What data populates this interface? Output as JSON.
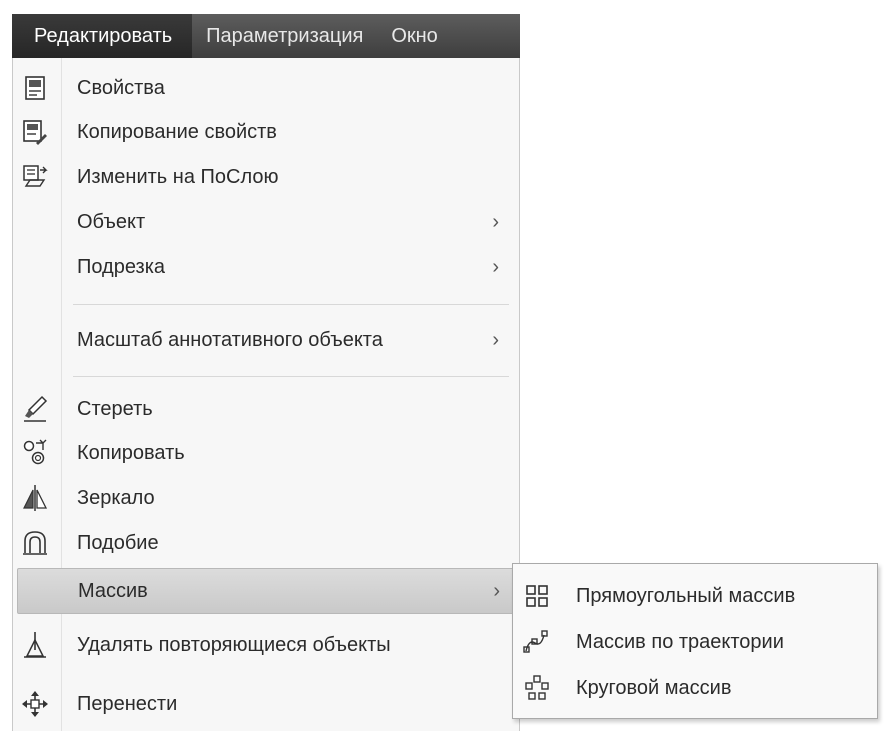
{
  "menubar": {
    "items": [
      {
        "label": "Редактировать"
      },
      {
        "label": "Параметризация"
      },
      {
        "label": "Окно"
      }
    ]
  },
  "edit_menu": {
    "items": [
      {
        "label": "Свойства",
        "icon": "properties-icon"
      },
      {
        "label": "Копирование свойств",
        "icon": "match-properties-icon"
      },
      {
        "label": "Изменить на ПоСлою",
        "icon": "change-to-bylayer-icon"
      },
      {
        "label": "Объект",
        "submenu_arrow": "›"
      },
      {
        "label": "Подрезка",
        "submenu_arrow": "›"
      },
      {
        "label": "Масштаб аннотативного объекта",
        "submenu_arrow": "›"
      },
      {
        "label": "Стереть",
        "icon": "erase-icon"
      },
      {
        "label": "Копировать",
        "icon": "copy-icon"
      },
      {
        "label": "Зеркало",
        "icon": "mirror-icon"
      },
      {
        "label": "Подобие",
        "icon": "offset-icon"
      },
      {
        "label": "Массив",
        "submenu_arrow": "›",
        "highlighted": true
      },
      {
        "label": "Удалять повторяющиеся объекты",
        "icon": "delete-duplicates-icon"
      },
      {
        "label": "Перенести",
        "icon": "move-icon"
      }
    ]
  },
  "array_submenu": {
    "items": [
      {
        "label": "Прямоугольный массив",
        "icon": "rectangular-array-icon"
      },
      {
        "label": "Массив по траектории",
        "icon": "path-array-icon"
      },
      {
        "label": "Круговой массив",
        "icon": "polar-array-icon"
      }
    ]
  }
}
